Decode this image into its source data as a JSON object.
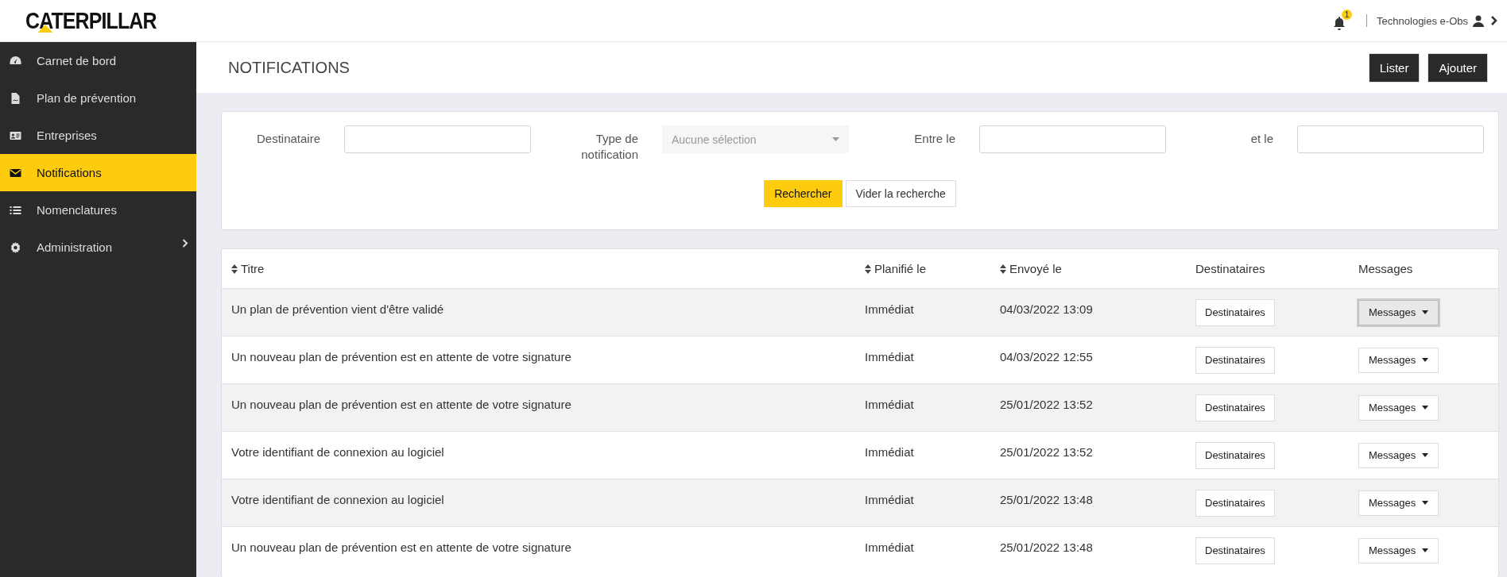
{
  "header": {
    "logo": "CATERPILLAR",
    "notification_count": "1",
    "user": "Technologies e-Obs"
  },
  "sidebar": {
    "items": [
      {
        "label": "Carnet de bord",
        "selected": false,
        "expandable": false
      },
      {
        "label": "Plan de prévention",
        "selected": false,
        "expandable": false
      },
      {
        "label": "Entreprises",
        "selected": false,
        "expandable": false
      },
      {
        "label": "Notifications",
        "selected": true,
        "expandable": false
      },
      {
        "label": "Nomenclatures",
        "selected": false,
        "expandable": false
      },
      {
        "label": "Administration",
        "selected": false,
        "expandable": true
      }
    ]
  },
  "page": {
    "title": "NOTIFICATIONS",
    "actions": [
      "Lister",
      "Ajouter"
    ]
  },
  "filters": {
    "fields": [
      {
        "label": "Destinataire",
        "kind": "text"
      },
      {
        "label": "Type de notification",
        "kind": "select",
        "placeholder": "Aucune sélection"
      },
      {
        "label": "Entre le",
        "kind": "text"
      },
      {
        "label": "et le",
        "kind": "text"
      }
    ],
    "buttons": [
      {
        "label": "Rechercher",
        "primary": true
      },
      {
        "label": "Vider la recherche",
        "primary": false
      }
    ]
  },
  "table": {
    "columns": [
      {
        "label": "Titre",
        "sortable": true
      },
      {
        "label": "Planifié le",
        "sortable": true
      },
      {
        "label": "Envoyé le",
        "sortable": true
      },
      {
        "label": "Destinataires",
        "sortable": false
      },
      {
        "label": "Messages",
        "sortable": false
      }
    ],
    "rows": [
      {
        "title": "Un plan de prévention vient d'être validé",
        "scheduled": "Immédiat",
        "sent": "04/03/2022 13:09",
        "recipients_button": "Destinataires",
        "messages_button": "Messages",
        "messages_focused": true
      },
      {
        "title": "Un nouveau plan de prévention est en attente de votre signature",
        "scheduled": "Immédiat",
        "sent": "04/03/2022 12:55",
        "recipients_button": "Destinataires",
        "messages_button": "Messages",
        "messages_focused": false
      },
      {
        "title": "Un nouveau plan de prévention est en attente de votre signature",
        "scheduled": "Immédiat",
        "sent": "25/01/2022 13:52",
        "recipients_button": "Destinataires",
        "messages_button": "Messages",
        "messages_focused": false
      },
      {
        "title": "Votre identifiant de connexion au logiciel",
        "scheduled": "Immédiat",
        "sent": "25/01/2022 13:52",
        "recipients_button": "Destinataires",
        "messages_button": "Messages",
        "messages_focused": false
      },
      {
        "title": "Votre identifiant de connexion au logiciel",
        "scheduled": "Immédiat",
        "sent": "25/01/2022 13:48",
        "recipients_button": "Destinataires",
        "messages_button": "Messages",
        "messages_focused": false
      },
      {
        "title": "Un nouveau plan de prévention est en attente de votre signature",
        "scheduled": "Immédiat",
        "sent": "25/01/2022 13:48",
        "recipients_button": "Destinataires",
        "messages_button": "Messages",
        "messages_focused": false
      }
    ]
  }
}
